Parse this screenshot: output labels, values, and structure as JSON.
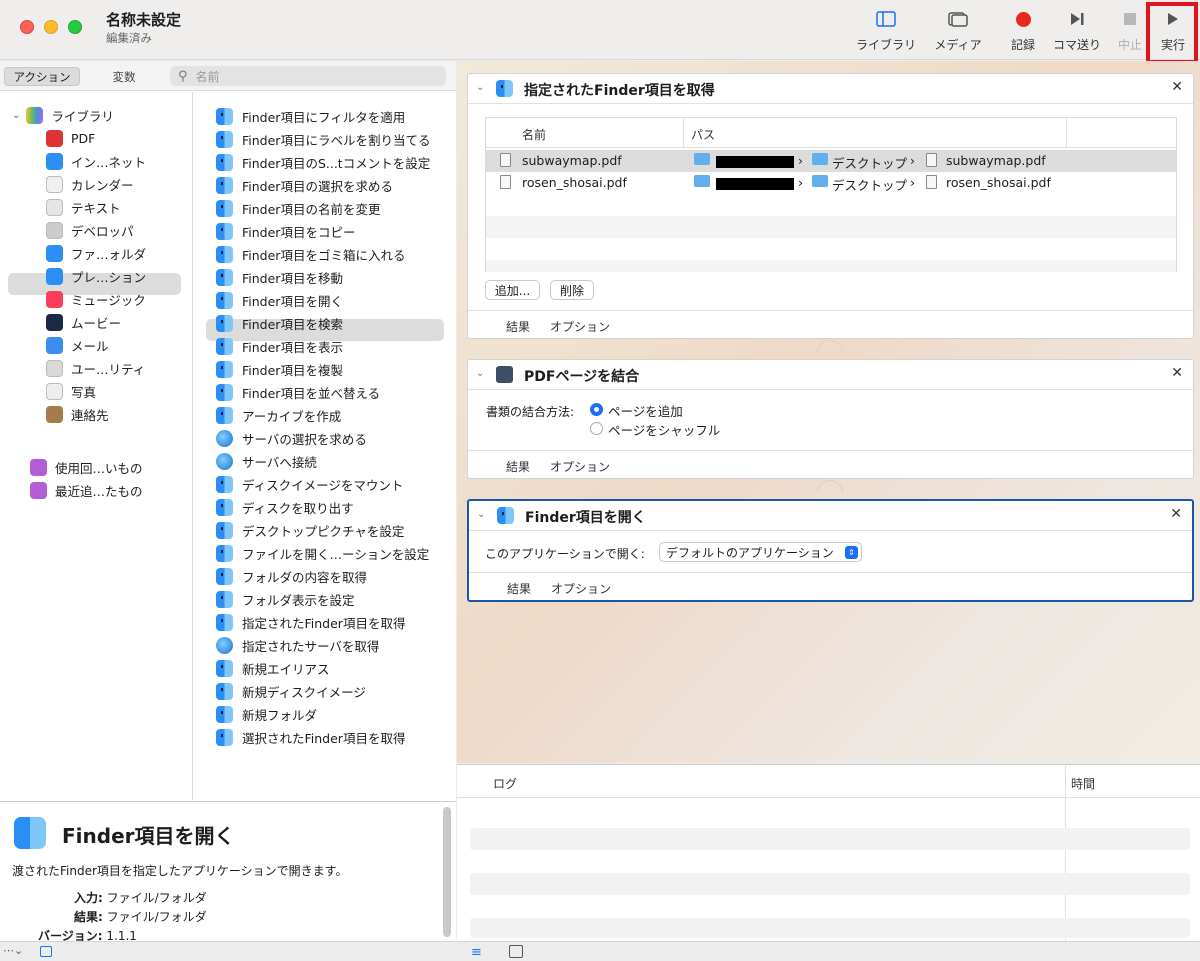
{
  "window": {
    "title": "名称未設定",
    "subtitle": "編集済み"
  },
  "toolbar": {
    "library": "ライブラリ",
    "media": "メディア",
    "record": "記録",
    "step": "コマ送り",
    "stop": "中止",
    "run": "実行"
  },
  "segments": {
    "actions": "アクション",
    "variables": "変数"
  },
  "search": {
    "placeholder": "名前"
  },
  "library": {
    "root": "ライブラリ",
    "items": [
      "PDF",
      "イン…ネット",
      "カレンダー",
      "テキスト",
      "デベロッパ",
      "ファ…ォルダ",
      "プレ…ション",
      "ミュージック",
      "ムービー",
      "メール",
      "ユー…リティ",
      "写真",
      "連絡先"
    ],
    "smart": [
      "使用回…いもの",
      "最近追…たもの"
    ],
    "selected": "ファ…ォルダ"
  },
  "actions": [
    "Finder項目にフィルタを適用",
    "Finder項目にラベルを割り当てる",
    "Finder項目のS...tコメントを設定",
    "Finder項目の選択を求める",
    "Finder項目の名前を変更",
    "Finder項目をコピー",
    "Finder項目をゴミ箱に入れる",
    "Finder項目を移動",
    "Finder項目を開く",
    "Finder項目を検索",
    "Finder項目を表示",
    "Finder項目を複製",
    "Finder項目を並べ替える",
    "アーカイブを作成",
    "サーバの選択を求める",
    "サーバへ接続",
    "ディスクイメージをマウント",
    "ディスクを取り出す",
    "デスクトップピクチャを設定",
    "ファイルを開く…ーションを設定",
    "フォルダの内容を取得",
    "フォルダ表示を設定",
    "指定されたFinder項目を取得",
    "指定されたサーバを取得",
    "新規エイリアス",
    "新規ディスクイメージ",
    "新規フォルダ",
    "選択されたFinder項目を取得"
  ],
  "description": {
    "title": "Finder項目を開く",
    "text": "渡されたFinder項目を指定したアプリケーションで開きます。",
    "input_label": "入力:",
    "input_value": "ファイル/フォルダ",
    "result_label": "結果:",
    "result_value": "ファイル/フォルダ",
    "version_label": "バージョン:",
    "version_value": "1.1.1"
  },
  "workflow": {
    "card1": {
      "title": "指定されたFinder項目を取得",
      "col_name": "名前",
      "col_path": "パス",
      "rows": [
        {
          "name": "subwaymap.pdf",
          "folder": "デスクトップ",
          "file": "subwaymap.pdf"
        },
        {
          "name": "rosen_shosai.pdf",
          "folder": "デスクトップ",
          "file": "rosen_shosai.pdf"
        }
      ],
      "add": "追加...",
      "remove": "削除",
      "results": "結果",
      "options": "オプション"
    },
    "card2": {
      "title": "PDFページを結合",
      "method_label": "書類の結合方法:",
      "opt1": "ページを追加",
      "opt2": "ページをシャッフル",
      "results": "結果",
      "options": "オプション"
    },
    "card3": {
      "title": "Finder項目を開く",
      "open_with_label": "このアプリケーションで開く:",
      "open_with_value": "デフォルトのアプリケーション",
      "results": "結果",
      "options": "オプション"
    }
  },
  "log": {
    "col_log": "ログ",
    "col_time": "時間"
  },
  "colors": {
    "accent": "#1a6ff3",
    "selected_border": "#1b57a8",
    "highlight": "#e0141e"
  }
}
